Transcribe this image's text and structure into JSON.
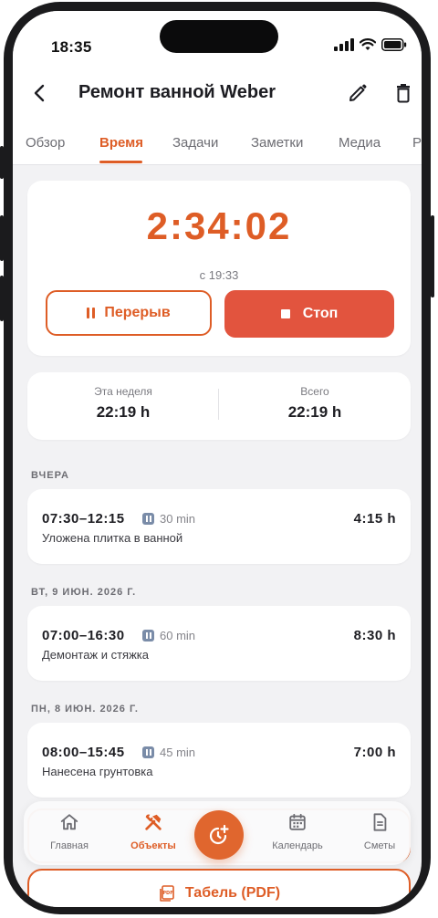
{
  "status_bar": {
    "time": "18:35"
  },
  "header": {
    "title": "Ремонт ванной Weber"
  },
  "tabs": [
    {
      "label": "Обзор",
      "active": false
    },
    {
      "label": "Время",
      "active": true
    },
    {
      "label": "Задачи",
      "active": false
    },
    {
      "label": "Заметки",
      "active": false
    },
    {
      "label": "Медиа",
      "active": false
    },
    {
      "label": "Ра",
      "active": false
    }
  ],
  "timer": {
    "value": "2:34:02",
    "since": "с 19:33",
    "pause_label": "Перерыв",
    "stop_label": "Стоп"
  },
  "stats": {
    "week_label": "Эта неделя",
    "week_value": "22:19 h",
    "total_label": "Всего",
    "total_value": "22:19 h"
  },
  "groups": [
    {
      "label": "ВЧЕРА",
      "entries": [
        {
          "range": "07:30–12:15",
          "break": "30 min",
          "total": "4:15 h",
          "note": "Уложена плитка в ванной"
        }
      ]
    },
    {
      "label": "ВТ, 9 ИЮН. 2026 Г.",
      "entries": [
        {
          "range": "07:00–16:30",
          "break": "60 min",
          "total": "8:30 h",
          "note": "Демонтаж и стяжка"
        }
      ]
    },
    {
      "label": "ПН, 8 ИЮН. 2026 Г.",
      "entries": [
        {
          "range": "08:00–15:45",
          "break": "45 min",
          "total": "7:00 h",
          "note": "Нанесена грунтовка"
        }
      ]
    }
  ],
  "bottom_nav": [
    {
      "label": "Главная",
      "icon": "home-icon",
      "active": false
    },
    {
      "label": "Объекты",
      "icon": "tools-icon",
      "active": true
    },
    {
      "label": "Календарь",
      "icon": "calendar-icon",
      "active": false
    },
    {
      "label": "Сметы",
      "icon": "document-icon",
      "active": false
    }
  ],
  "pdf_button": {
    "label": "Табель (PDF)"
  },
  "colors": {
    "accent": "#de5d26",
    "stop": "#e2543e",
    "background": "#f2f2f4"
  }
}
